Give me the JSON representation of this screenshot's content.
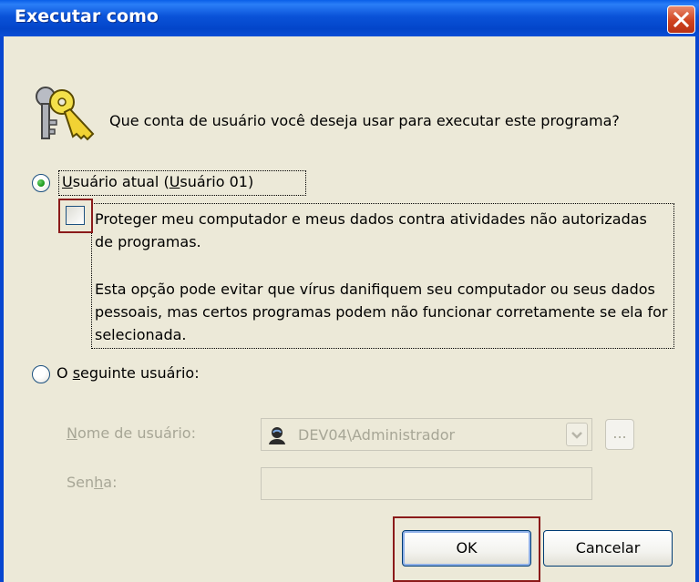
{
  "window": {
    "title": "Executar como"
  },
  "question": "Que conta de usuário você deseja usar para executar este programa?",
  "current_user": {
    "label_underlined": "U",
    "label_rest": "suário atual (",
    "user_underlined": "U",
    "user_rest": "suário 01)"
  },
  "protect": {
    "text": "Proteger meu computador e meus dados contra atividades não autorizadas de programas.",
    "warning": "Esta opção pode evitar que vírus danifiquem seu computador ou seus dados pessoais, mas certos programas podem não funcionar corretamente se ela for selecionada."
  },
  "other_user": {
    "label_before": "O ",
    "label_underlined": "s",
    "label_after": "eguinte usuário:"
  },
  "username": {
    "label_underlined": "N",
    "label_rest": "ome de usuário:",
    "value": "DEV04\\Administrador",
    "browse": "..."
  },
  "password": {
    "label_before": "Sen",
    "label_underlined": "h",
    "label_after": "a:",
    "value": ""
  },
  "buttons": {
    "ok": "OK",
    "cancel": "Cancelar"
  },
  "state": {
    "current_user_selected": true,
    "protect_checked": false
  },
  "colors": {
    "titlebar": "#0a52d8",
    "dialog_bg": "#ece9d8",
    "highlight": "#8b1a1a",
    "disabled_text": "#a7a696"
  }
}
